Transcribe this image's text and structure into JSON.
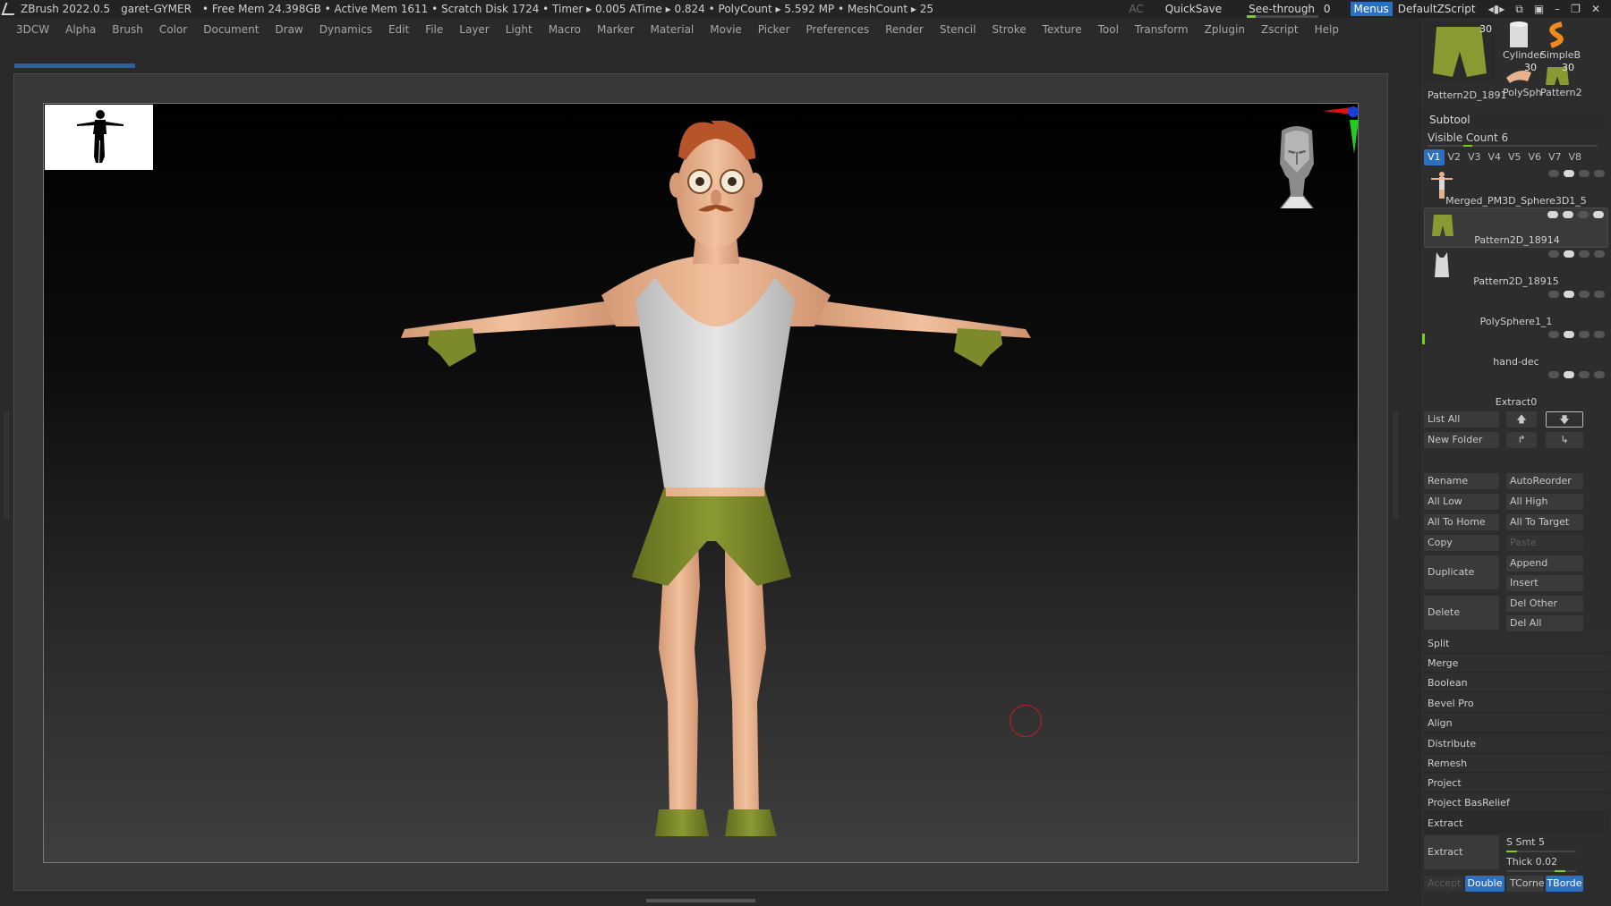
{
  "titlebar": {
    "app": "ZBrush 2022.0.5",
    "project": "garet-GYMER",
    "stats": "• Free Mem 24.398GB • Active Mem 1611 • Scratch Disk 1724 •  Timer ▸ 0.005 ATime ▸ 0.824 • PolyCount ▸ 5.592 MP  • MeshCount ▸ 25",
    "ac": "AC",
    "quicksave": "QuickSave",
    "seethrough": "See-through",
    "seethrough_value": "0",
    "menus": "Menus",
    "script": "DefaultZScript"
  },
  "menubar": [
    "3DCW",
    "Alpha",
    "Brush",
    "Color",
    "Document",
    "Draw",
    "Dynamics",
    "Edit",
    "File",
    "Layer",
    "Light",
    "Macro",
    "Marker",
    "Material",
    "Movie",
    "Picker",
    "Preferences",
    "Render",
    "Stencil",
    "Stroke",
    "Texture",
    "Tool",
    "Transform",
    "Zplugin",
    "Zscript",
    "Help"
  ],
  "tool_thumbs": {
    "main_label": "Pattern2D_1891",
    "main_count": "30",
    "items": [
      {
        "label": "Cylinder"
      },
      {
        "label": "SimpleB"
      },
      {
        "label": "PolySph",
        "count": "30"
      },
      {
        "label": "Pattern2",
        "count": "30"
      }
    ]
  },
  "subtool": {
    "header": "Subtool",
    "visible_count_label": "Visible Count 6",
    "visible_fraction": 0.1,
    "views": [
      "V1",
      "V2",
      "V3",
      "V4",
      "V5",
      "V6",
      "V7",
      "V8"
    ],
    "active_view": "V1",
    "items": [
      {
        "name": "Merged_PM3D_Sphere3D1_5",
        "selected": false
      },
      {
        "name": "Pattern2D_18914",
        "selected": true
      },
      {
        "name": "Pattern2D_18915",
        "selected": false
      },
      {
        "name": "PolySphere1_1",
        "selected": false
      },
      {
        "name": "hand-dec",
        "selected": false
      },
      {
        "name": "Extract0",
        "selected": false
      }
    ]
  },
  "panel": {
    "list_all": "List All",
    "new_folder": "New Folder",
    "rename": "Rename",
    "auto_reorder": "AutoReorder",
    "all_low": "All Low",
    "all_high": "All High",
    "all_to_home": "All To Home",
    "all_to_target": "All To Target",
    "copy": "Copy",
    "paste": "Paste",
    "duplicate": "Duplicate",
    "append": "Append",
    "insert": "Insert",
    "delete": "Delete",
    "del_other": "Del Other",
    "del_all": "Del All",
    "split": "Split",
    "merge": "Merge",
    "boolean": "Boolean",
    "bevel_pro": "Bevel Pro",
    "align": "Align",
    "distribute": "Distribute",
    "remesh": "Remesh",
    "project": "Project",
    "project_basrelief": "Project BasRelief",
    "extract_section": "Extract",
    "extract_btn": "Extract",
    "s_smt": "S Smt 5",
    "thick": "Thick 0.02",
    "accept": "Accept",
    "double": "Double",
    "tcorner": "TCorne",
    "tborder": "TBorde"
  },
  "colors": {
    "accent": "#2e6fc0",
    "slider": "#7ccd1f",
    "skin": "#e8b28e",
    "shorts": "#7c8a2c",
    "tank": "#d6d6d6",
    "hair": "#b8542a"
  }
}
